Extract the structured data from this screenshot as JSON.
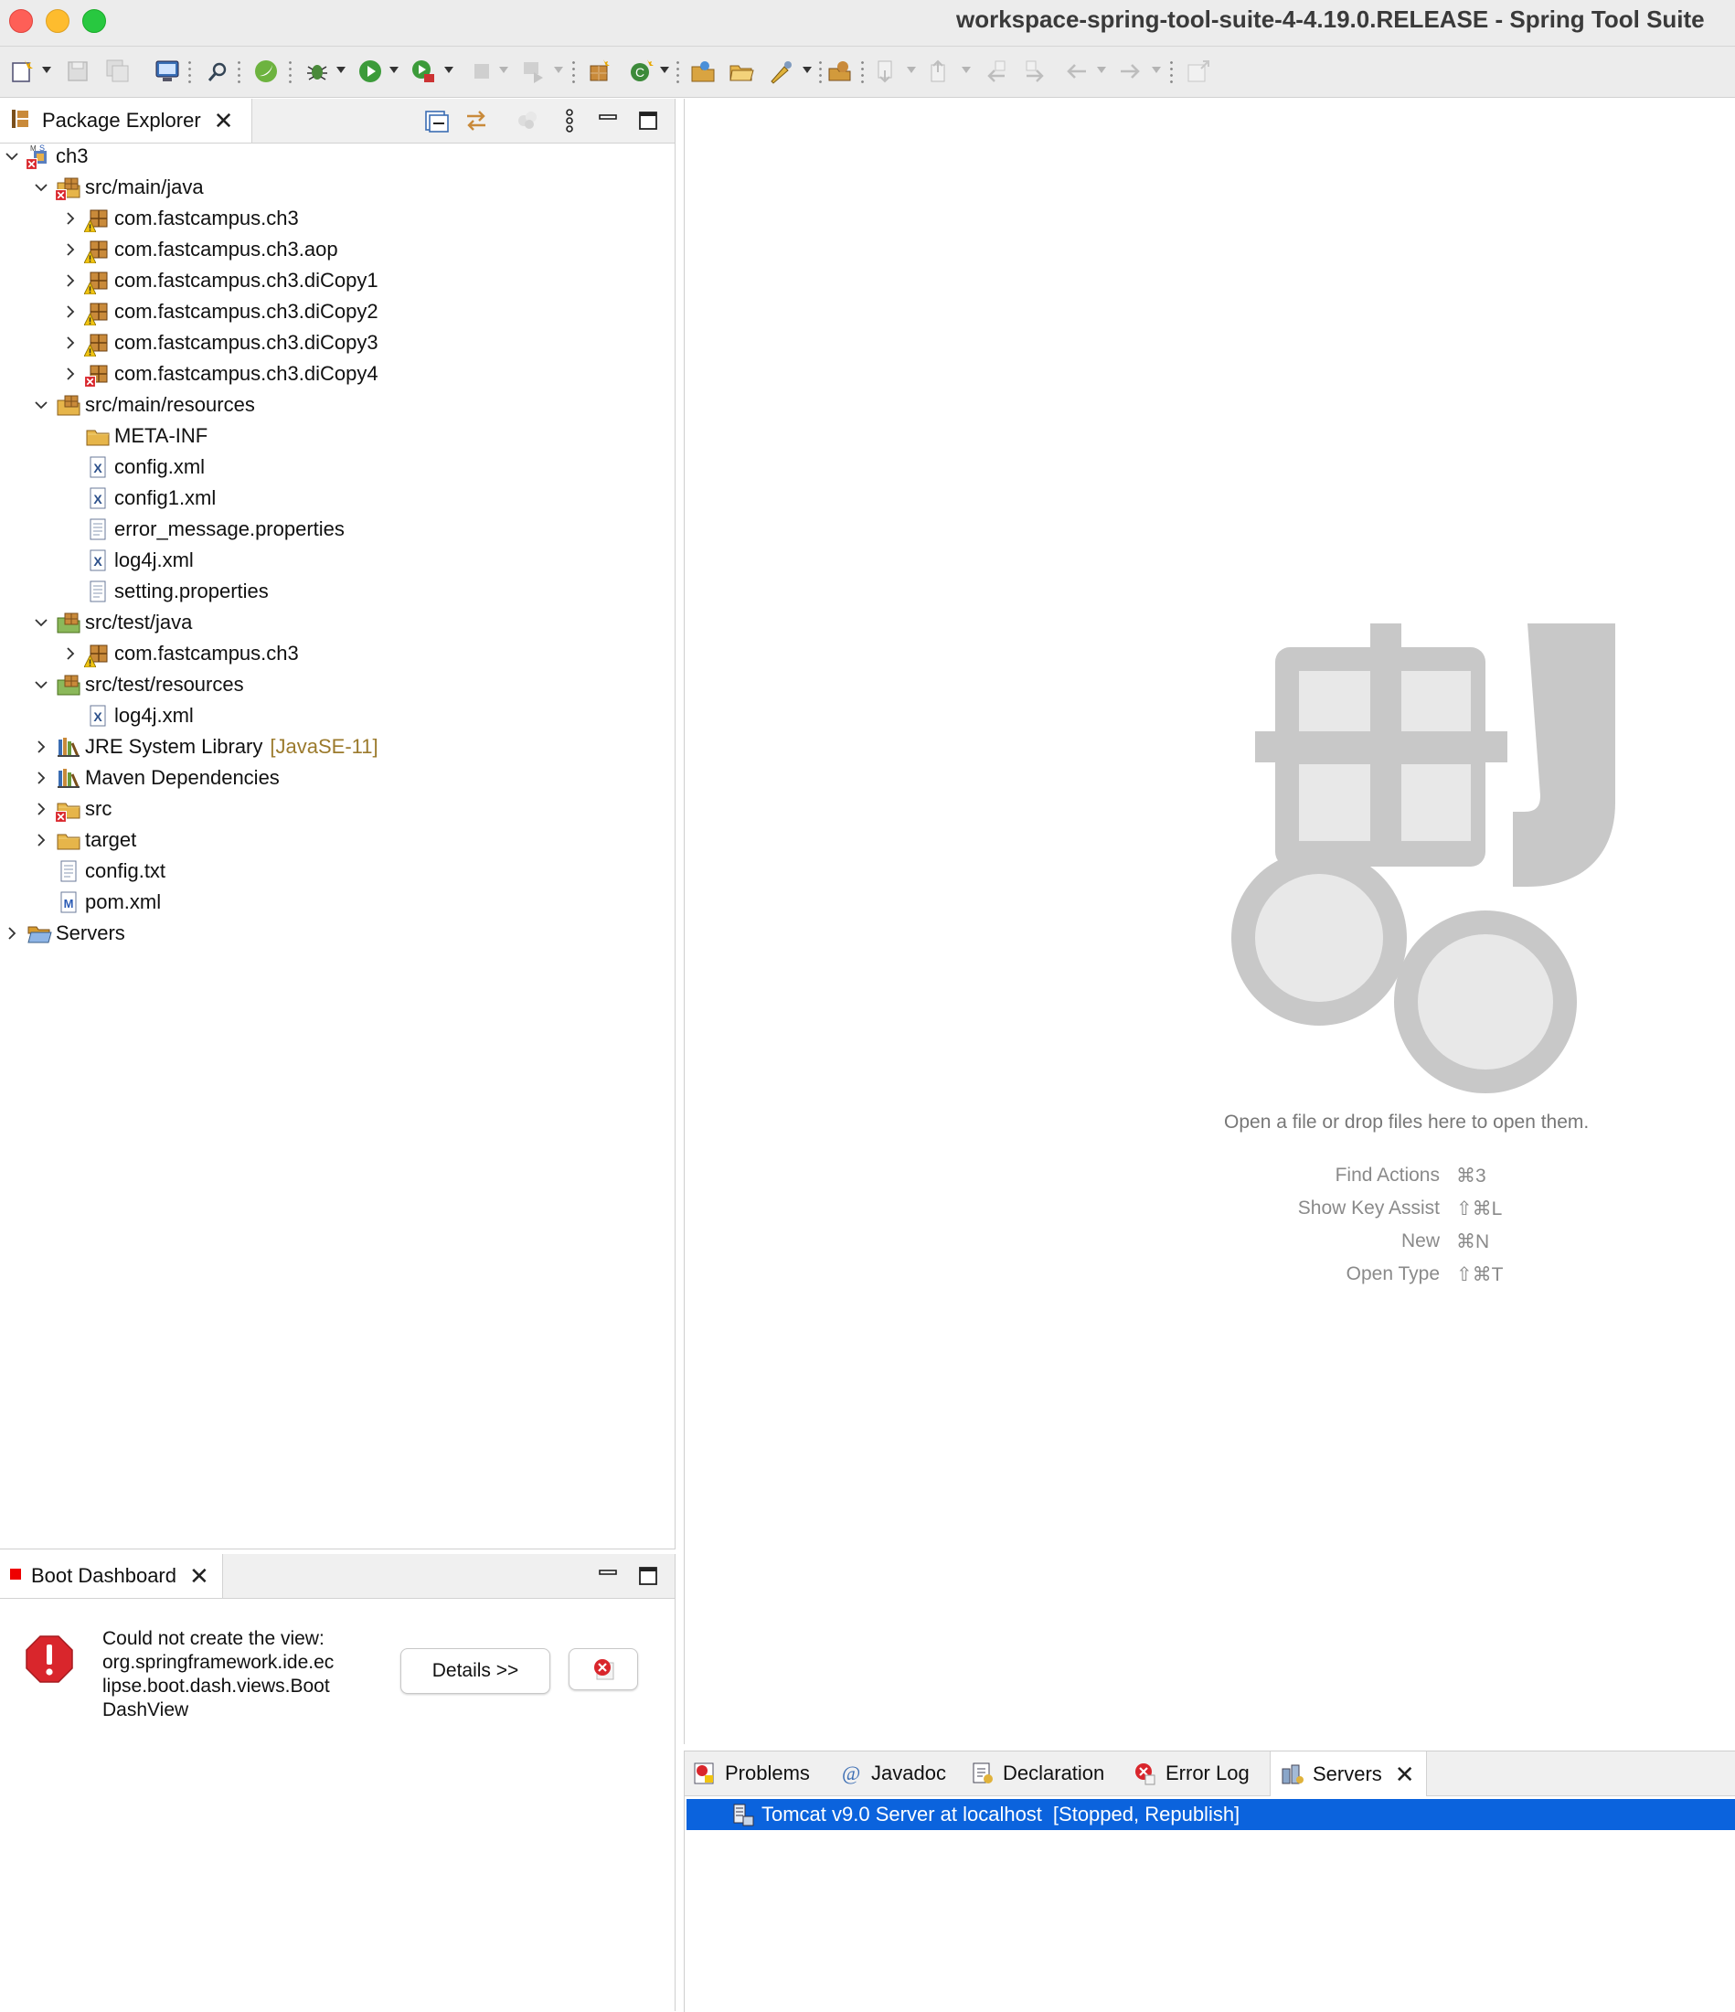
{
  "window": {
    "title": "workspace-spring-tool-suite-4-4.19.0.RELEASE - Spring Tool Suite"
  },
  "toolbar": {
    "buttons": [
      "new-icon",
      "save-icon",
      "save-all-icon",
      "terminal-icon",
      "search-icon",
      "spring-icon",
      "debug-icon",
      "run-icon",
      "coverage-icon",
      "stop-icon",
      "connect-icon",
      "new-package-icon",
      "new-class-icon",
      "open-type-icon",
      "open-folder-icon",
      "annotation-icon",
      "open-task-icon",
      "next-annotation-icon",
      "prev-annotation-icon",
      "last-edit-icon",
      "forward-edit-icon",
      "back-icon",
      "forward-icon",
      "pin-editor-icon"
    ]
  },
  "package_explorer": {
    "tab_label": "Package Explorer",
    "tree": [
      {
        "label": "ch3",
        "depth": 0,
        "expanded": true,
        "icon": "maven-project-icon",
        "error": true
      },
      {
        "label": "src/main/java",
        "depth": 1,
        "expanded": true,
        "icon": "source-folder-icon",
        "error": true
      },
      {
        "label": "com.fastcampus.ch3",
        "depth": 2,
        "expanded": false,
        "icon": "package-icon",
        "warning": true
      },
      {
        "label": "com.fastcampus.ch3.aop",
        "depth": 2,
        "expanded": false,
        "icon": "package-icon",
        "warning": true
      },
      {
        "label": "com.fastcampus.ch3.diCopy1",
        "depth": 2,
        "expanded": false,
        "icon": "package-icon",
        "warning": true
      },
      {
        "label": "com.fastcampus.ch3.diCopy2",
        "depth": 2,
        "expanded": false,
        "icon": "package-icon",
        "warning": true
      },
      {
        "label": "com.fastcampus.ch3.diCopy3",
        "depth": 2,
        "expanded": false,
        "icon": "package-icon",
        "warning": true
      },
      {
        "label": "com.fastcampus.ch3.diCopy4",
        "depth": 2,
        "expanded": false,
        "icon": "package-icon",
        "error": true
      },
      {
        "label": "src/main/resources",
        "depth": 1,
        "expanded": true,
        "icon": "resource-folder-icon"
      },
      {
        "label": "META-INF",
        "depth": 2,
        "icon": "folder-icon"
      },
      {
        "label": "config.xml",
        "depth": 2,
        "icon": "xml-file-icon"
      },
      {
        "label": "config1.xml",
        "depth": 2,
        "icon": "xml-file-icon"
      },
      {
        "label": "error_message.properties",
        "depth": 2,
        "icon": "text-file-icon"
      },
      {
        "label": "log4j.xml",
        "depth": 2,
        "icon": "xml-file-icon"
      },
      {
        "label": "setting.properties",
        "depth": 2,
        "icon": "text-file-icon"
      },
      {
        "label": "src/test/java",
        "depth": 1,
        "expanded": true,
        "icon": "test-folder-icon"
      },
      {
        "label": "com.fastcampus.ch3",
        "depth": 2,
        "expanded": false,
        "icon": "package-icon",
        "warning": true
      },
      {
        "label": "src/test/resources",
        "depth": 1,
        "expanded": true,
        "icon": "test-resource-folder-icon"
      },
      {
        "label": "log4j.xml",
        "depth": 2,
        "icon": "xml-file-icon"
      },
      {
        "label": "JRE System Library",
        "decoration": "[JavaSE-11]",
        "depth": 1,
        "expanded": false,
        "icon": "library-icon"
      },
      {
        "label": "Maven Dependencies",
        "depth": 1,
        "expanded": false,
        "icon": "library-icon"
      },
      {
        "label": "src",
        "depth": 1,
        "expanded": false,
        "icon": "folder-icon",
        "error": true
      },
      {
        "label": "target",
        "depth": 1,
        "expanded": false,
        "icon": "folder-icon"
      },
      {
        "label": "config.txt",
        "depth": 1,
        "icon": "text-file-icon"
      },
      {
        "label": "pom.xml",
        "depth": 1,
        "icon": "maven-pom-icon"
      },
      {
        "label": "Servers",
        "depth": 0,
        "expanded": false,
        "icon": "open-folder-icon"
      }
    ]
  },
  "editor": {
    "drop_text": "Open a file or drop files here to open them.",
    "shortcuts": [
      {
        "label": "Find Actions",
        "key": "⌘3"
      },
      {
        "label": "Show Key Assist",
        "key": "⇧⌘L"
      },
      {
        "label": "New",
        "key": "⌘N"
      },
      {
        "label": "Open Type",
        "key": "⇧⌘T"
      }
    ]
  },
  "boot_dashboard": {
    "tab_label": "Boot Dashboard",
    "error_lines": [
      "Could not create the view:",
      "org.springframework.ide.ec",
      "lipse.boot.dash.views.Boot",
      "DashView"
    ],
    "details_button": "Details >>"
  },
  "bottom_tabs": {
    "tabs": [
      {
        "label": "Problems",
        "icon": "problems-icon"
      },
      {
        "label": "Javadoc",
        "icon": "javadoc-icon"
      },
      {
        "label": "Declaration",
        "icon": "declaration-icon"
      },
      {
        "label": "Error Log",
        "icon": "error-log-icon"
      },
      {
        "label": "Servers",
        "icon": "servers-icon",
        "active": true
      }
    ],
    "servers": [
      {
        "name": "Tomcat v9.0 Server at localhost",
        "state": "[Stopped, Republish]"
      }
    ]
  },
  "colors": {
    "selection": "#0b63dd",
    "error": "#d9262c",
    "warning": "#f1c40f",
    "watermark": "#c8c8c8"
  }
}
